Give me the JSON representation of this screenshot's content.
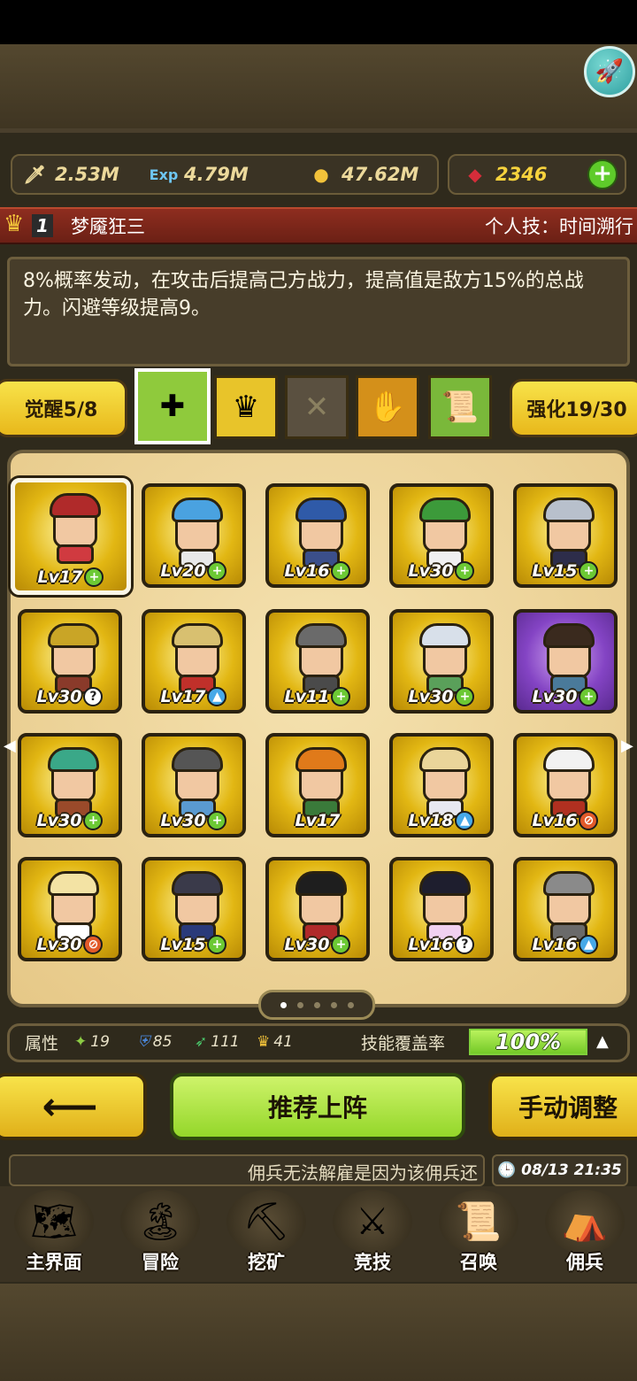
{
  "resources": {
    "attack": "2.53M",
    "exp": "4.79M",
    "gold": "47.62M",
    "gems": "2346"
  },
  "hero": {
    "rank": "1",
    "name": "梦魇狂三",
    "skill": "个人技：时间溯行",
    "description": "8%概率发动，在攻击后提高己方战力，提高值是敌方15%的总战力。闪避等级提高9。"
  },
  "awaken": {
    "label": "觉醒5/8"
  },
  "enhance": {
    "label": "强化19/30"
  },
  "slots": [
    {
      "icon": "skill-tree-icon",
      "glyph": "✚",
      "selected": true
    },
    {
      "icon": "crown-up-icon",
      "glyph": "♛"
    },
    {
      "icon": "empty-slot-icon",
      "glyph": "✕"
    },
    {
      "icon": "gauntlet-icon",
      "glyph": "✋"
    },
    {
      "icon": "scroll-icon",
      "glyph": "📜"
    }
  ],
  "heroes": [
    {
      "lv": "Lv17",
      "badge": "plus",
      "hair": "#b02a2a",
      "cloth": "#d03a40",
      "selected": true
    },
    {
      "lv": "Lv20",
      "badge": "plus",
      "hair": "#4aa2e0",
      "cloth": "#e8e8e8"
    },
    {
      "lv": "Lv16",
      "badge": "plus",
      "hair": "#2f5aa8",
      "cloth": "#3b4f8a"
    },
    {
      "lv": "Lv30",
      "badge": "plus",
      "hair": "#3c9a3a",
      "cloth": "#f0f0f0"
    },
    {
      "lv": "Lv15",
      "badge": "plus",
      "hair": "#b8c0cc",
      "cloth": "#2d2d4a"
    },
    {
      "lv": "Lv30",
      "badge": "question",
      "hair": "#c9a526",
      "cloth": "#8a3a2a"
    },
    {
      "lv": "Lv17",
      "badge": "up",
      "hair": "#d8c070",
      "cloth": "#c0302a"
    },
    {
      "lv": "Lv11",
      "badge": "plus",
      "hair": "#6a6a6a",
      "cloth": "#4a4a4a"
    },
    {
      "lv": "Lv30",
      "badge": "plus",
      "hair": "#d8e0ea",
      "cloth": "#5aa05a"
    },
    {
      "lv": "Lv30",
      "badge": "plus",
      "hair": "#3a2a1e",
      "cloth": "#4a7a9a",
      "purple": true
    },
    {
      "lv": "Lv30",
      "badge": "plus",
      "hair": "#3aa888",
      "cloth": "#9a4a2a"
    },
    {
      "lv": "Lv30",
      "badge": "plus",
      "hair": "#555555",
      "cloth": "#5a9ad0"
    },
    {
      "lv": "Lv17",
      "badge": "",
      "hair": "#e07a1a",
      "cloth": "#3a7a3a"
    },
    {
      "lv": "Lv18",
      "badge": "up",
      "hair": "#ead59a",
      "cloth": "#e8e8f0"
    },
    {
      "lv": "Lv16",
      "badge": "no",
      "hair": "#f2f2f2",
      "cloth": "#b03020"
    },
    {
      "lv": "Lv30",
      "badge": "no",
      "hair": "#f3e3a4",
      "cloth": "#ffffff"
    },
    {
      "lv": "Lv15",
      "badge": "plus",
      "hair": "#3a3a4a",
      "cloth": "#2a3a7a"
    },
    {
      "lv": "Lv30",
      "badge": "plus",
      "hair": "#1e1e1e",
      "cloth": "#b02a2a"
    },
    {
      "lv": "Lv16",
      "badge": "question",
      "hair": "#1e1e2e",
      "cloth": "#f0d0f0"
    },
    {
      "lv": "Lv16",
      "badge": "up",
      "hair": "#8a8a8a",
      "cloth": "#6a6a6a"
    }
  ],
  "stats": {
    "label": "属性",
    "values": [
      "19",
      "85",
      "111",
      "41"
    ],
    "coverage_label": "技能覆盖率",
    "coverage": "100%",
    "coverage_fraction": 1.0
  },
  "actions": {
    "recommend": "推荐上阵",
    "manual": "手动调整",
    "back_icon": "left-arrow-icon"
  },
  "ticker": {
    "text": "佣兵无法解雇是因为该佣兵还",
    "datetime": "08/13 21:35"
  },
  "nav": [
    {
      "label": "主界面",
      "icon": "map-scroll-icon",
      "glyph": "🗺"
    },
    {
      "label": "冒险",
      "icon": "island-icon",
      "glyph": "🏝"
    },
    {
      "label": "挖矿",
      "icon": "pickaxe-icon",
      "glyph": "⛏"
    },
    {
      "label": "竞技",
      "icon": "crossed-swords-icon",
      "glyph": "⚔"
    },
    {
      "label": "召唤",
      "icon": "summon-scroll-icon",
      "glyph": "📜"
    },
    {
      "label": "佣兵",
      "icon": "tent-icon",
      "glyph": "⛺"
    }
  ]
}
